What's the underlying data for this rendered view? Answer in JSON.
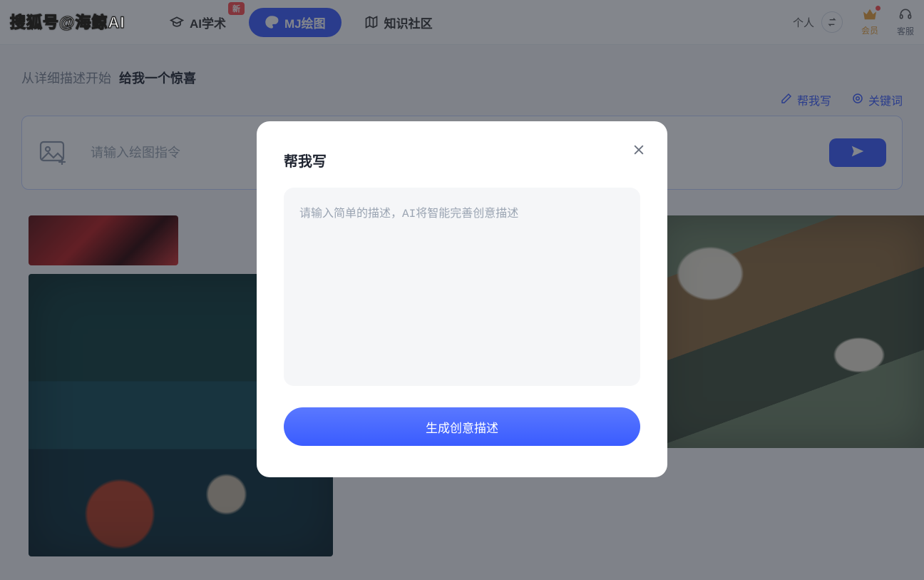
{
  "brand_text": "搜狐号@海鲸AI",
  "nav": {
    "items": [
      {
        "label": "AI学术",
        "badge": "新"
      },
      {
        "label": "MJ绘图"
      },
      {
        "label": "知识社区"
      }
    ]
  },
  "nav_right": {
    "persona_label": "个人",
    "vip_label": "会员",
    "support_label": "客服"
  },
  "page": {
    "instruction_prefix": "从详细描述开始",
    "instruction_bold": "给我一个惊喜",
    "tool_links": {
      "help_write": "帮我写",
      "keywords": "关键词"
    },
    "prompt_placeholder": "请输入绘图指令"
  },
  "modal": {
    "title": "帮我写",
    "textarea_placeholder": "请输入简单的描述，AI将智能完善创意描述",
    "submit_label": "生成创意描述"
  }
}
